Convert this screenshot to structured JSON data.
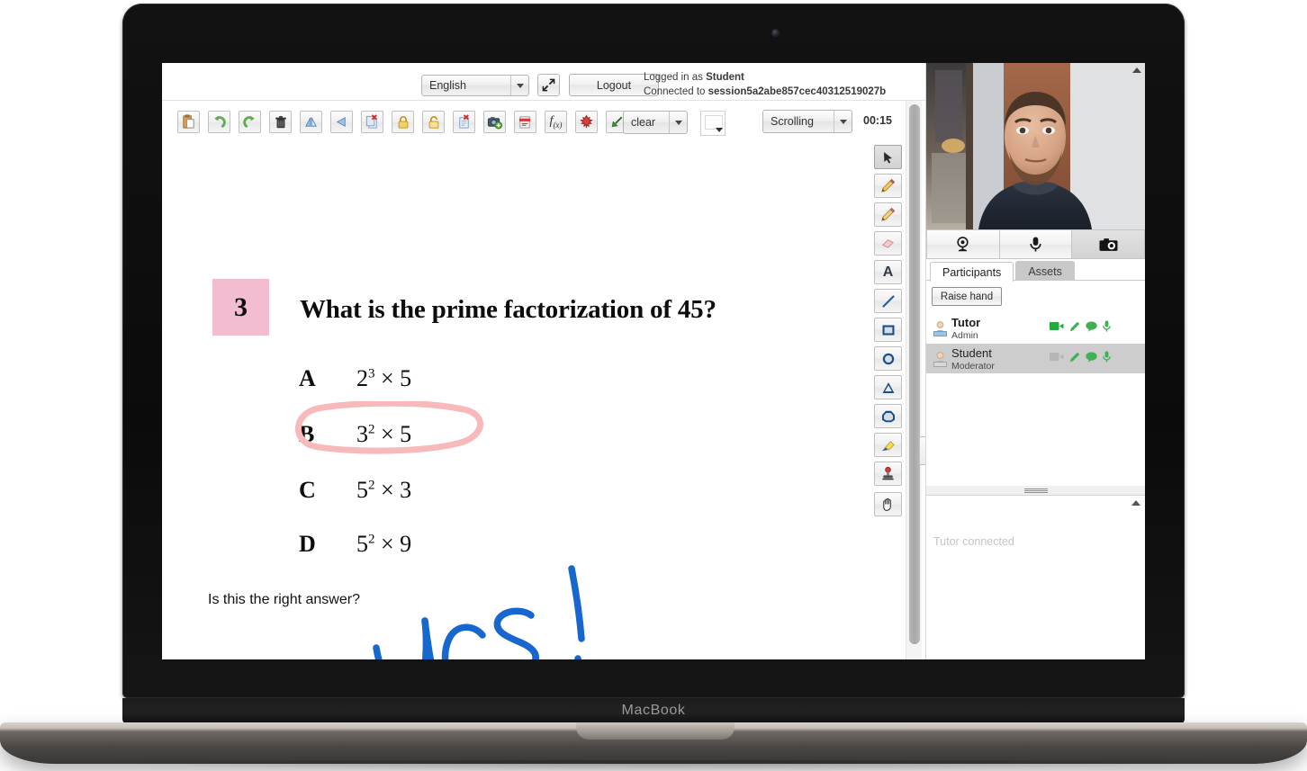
{
  "device": {
    "wordmark": "MacBook",
    "camera_icon": "webcam-dot-icon"
  },
  "topbar": {
    "language": "English",
    "fullscreen_icon": "expand-arrows-icon",
    "logout_label": "Logout",
    "logged_in_prefix": "Logged in as ",
    "logged_in_user": "Student",
    "connected_prefix": "Connected to ",
    "session_id": "session5a2abe857cec40312519027b"
  },
  "toolbar": {
    "buttons": [
      {
        "name": "paste-icon",
        "title": "Paste"
      },
      {
        "name": "undo-icon",
        "title": "Undo"
      },
      {
        "name": "redo-icon",
        "title": "Redo"
      },
      {
        "name": "trash-icon",
        "title": "Delete"
      },
      {
        "name": "flip-vertical-icon",
        "title": "Flip vertical"
      },
      {
        "name": "flip-horizontal-icon",
        "title": "Flip horizontal"
      },
      {
        "name": "delete-page-icon",
        "title": "Delete page"
      },
      {
        "name": "lock-closed-icon",
        "title": "Lock"
      },
      {
        "name": "lock-open-icon",
        "title": "Unlock"
      },
      {
        "name": "remove-document-icon",
        "title": "Remove document"
      },
      {
        "name": "add-snapshot-icon",
        "title": "Add snapshot"
      },
      {
        "name": "export-pdf-icon",
        "title": "Export PDF"
      },
      {
        "name": "formula-icon",
        "title": "Formula"
      },
      {
        "name": "maple-icon",
        "title": "Maple"
      },
      {
        "name": "pointer-arrow-icon",
        "title": "Pointer"
      }
    ],
    "clear_label": "clear",
    "color_swatch": "#ffffff",
    "mode_label": "Scrolling",
    "timer": "00:15"
  },
  "palette": {
    "tools": [
      {
        "name": "cursor-tool",
        "label": "Select",
        "active": true
      },
      {
        "name": "pencil-tool",
        "label": "Pencil",
        "active": false
      },
      {
        "name": "pencil2-tool",
        "label": "Pencil 2",
        "active": false
      },
      {
        "name": "eraser-tool",
        "label": "Eraser",
        "active": false
      },
      {
        "name": "text-tool",
        "label": "Text",
        "active": false
      },
      {
        "name": "line-tool",
        "label": "Line",
        "active": false
      },
      {
        "name": "rectangle-tool",
        "label": "Rectangle",
        "active": false
      },
      {
        "name": "circle-tool",
        "label": "Circle",
        "active": false
      },
      {
        "name": "triangle-tool",
        "label": "Triangle",
        "active": false
      },
      {
        "name": "polygon-tool",
        "label": "Polygon",
        "active": false
      },
      {
        "name": "highlighter-tool",
        "label": "Highlighter",
        "active": false
      },
      {
        "name": "stamp-tool",
        "label": "Stamp",
        "active": false
      },
      {
        "name": "hand-tool",
        "label": "Pan",
        "active": false
      }
    ]
  },
  "whiteboard": {
    "question_number": "3",
    "question_number_bg": "#f2bcd1",
    "question_text": "What is the prime factorization of 45?",
    "answers": [
      {
        "letter": "A",
        "base1": "2",
        "exp": "3",
        "times": "×",
        "base2": "5"
      },
      {
        "letter": "B",
        "base1": "3",
        "exp": "2",
        "times": "×",
        "base2": "5"
      },
      {
        "letter": "C",
        "base1": "5",
        "exp": "2",
        "times": "×",
        "base2": "3"
      },
      {
        "letter": "D",
        "base1": "5",
        "exp": "2",
        "times": "×",
        "base2": "9"
      }
    ],
    "prompt_text": "Is this the right answer?",
    "annotations": {
      "circle_target": "B",
      "circle_color": "#f7b9b9",
      "handwriting_text": "yes!",
      "handwriting_color": "#1767cf"
    }
  },
  "right_panel": {
    "video": {
      "label": "tutor-webcam-feed"
    },
    "media_buttons": [
      {
        "name": "webcam-icon",
        "label": "Webcam",
        "active": false
      },
      {
        "name": "microphone-icon",
        "label": "Mic",
        "active": false
      },
      {
        "name": "camera-icon",
        "label": "Snapshot",
        "active": true
      }
    ],
    "tabs": [
      {
        "label": "Participants",
        "active": true
      },
      {
        "label": "Assets",
        "active": false
      }
    ],
    "raise_hand_label": "Raise hand",
    "participants": [
      {
        "name": "Tutor",
        "role": "Admin",
        "selected": false,
        "bold": true,
        "video_on": true,
        "icons": [
          "video-camera-icon",
          "pencil-icon",
          "chat-bubble-icon",
          "microphone-icon"
        ]
      },
      {
        "name": "Student",
        "role": "Moderator",
        "selected": true,
        "bold": false,
        "video_on": false,
        "icons": [
          "video-camera-icon",
          "pencil-icon",
          "chat-bubble-icon",
          "microphone-icon"
        ]
      }
    ],
    "chat": {
      "message": "Tutor connected"
    }
  }
}
